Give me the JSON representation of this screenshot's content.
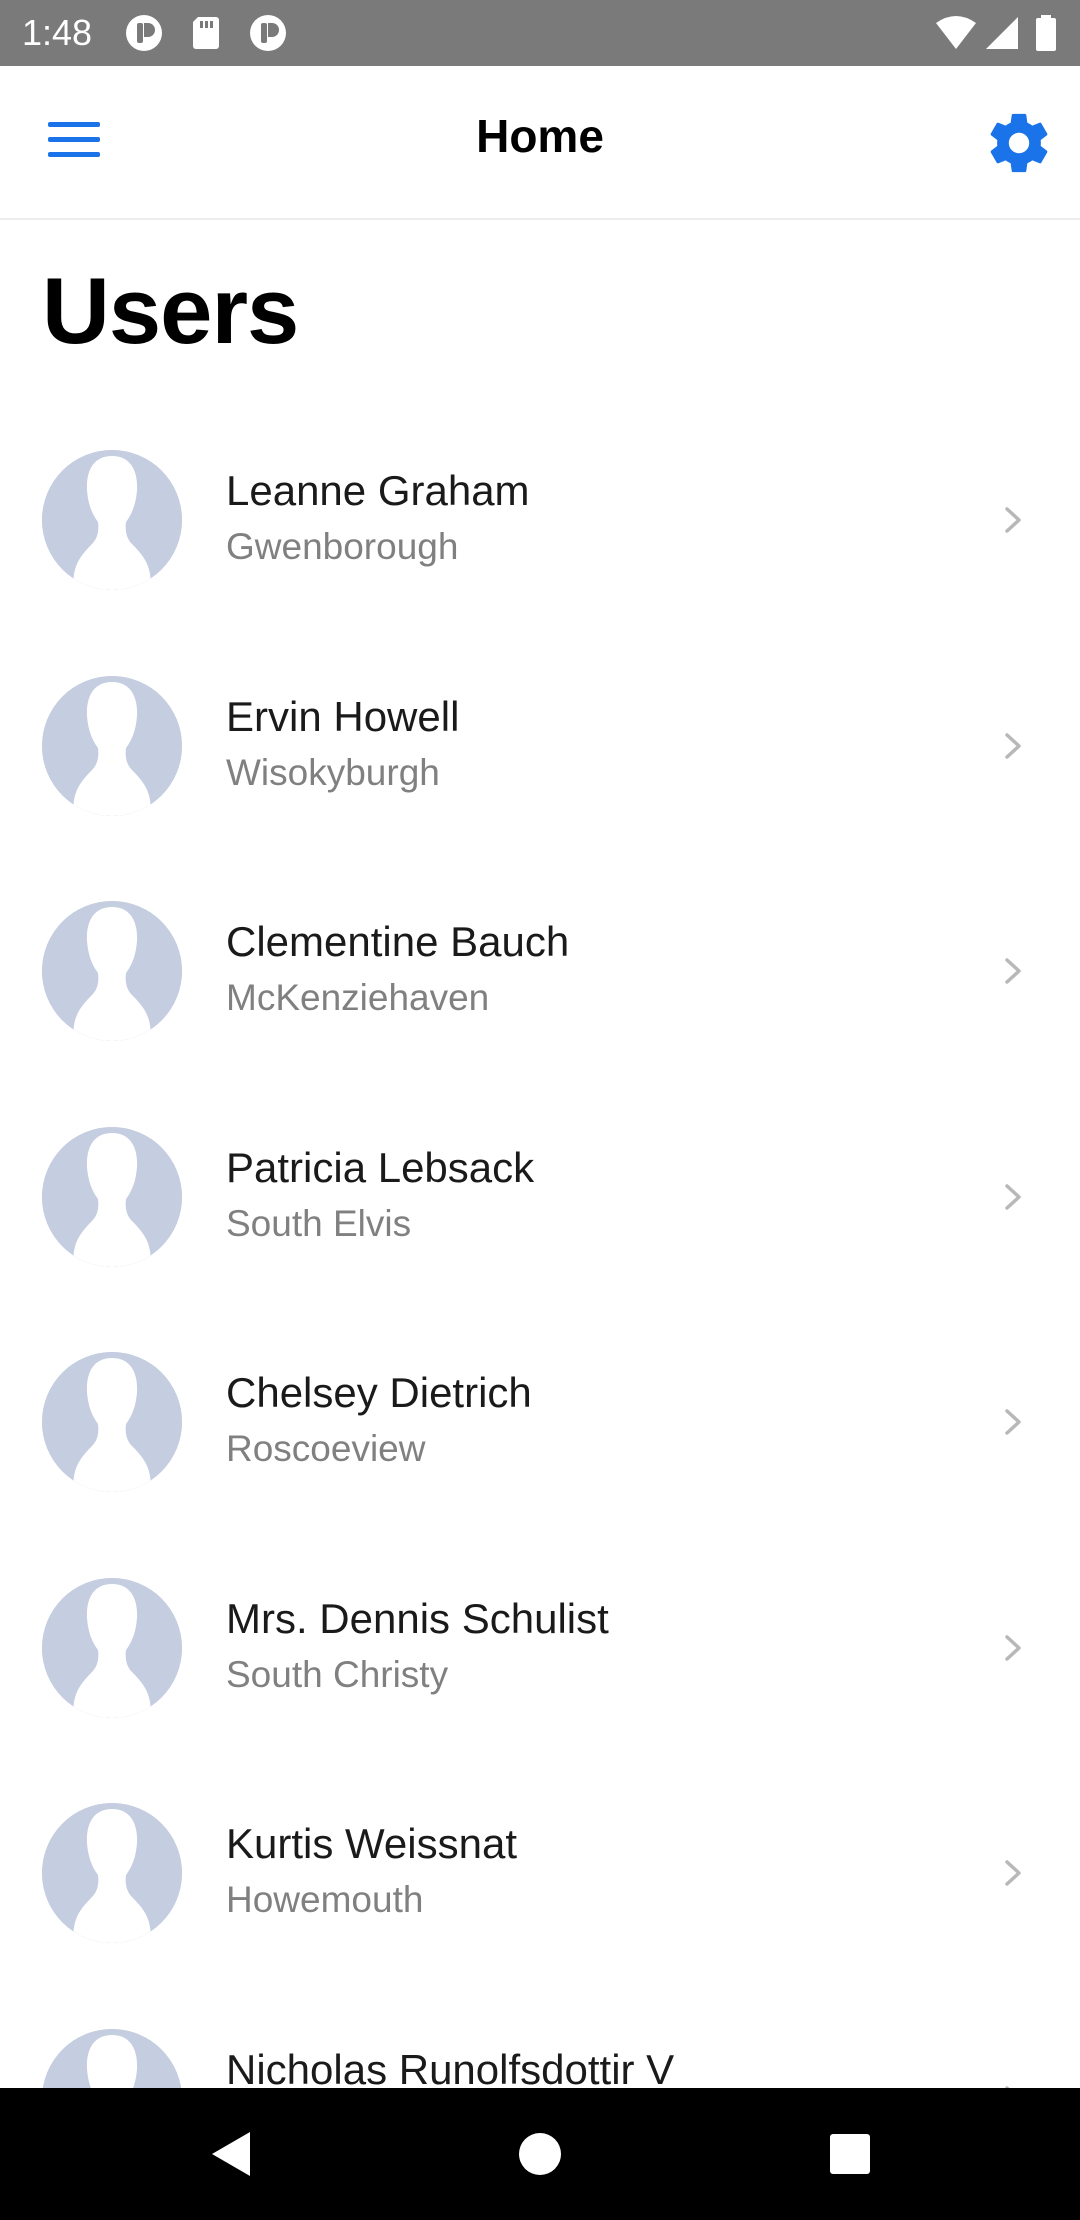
{
  "status_bar": {
    "time": "1:48",
    "left_icons": [
      "notification-app-icon",
      "sd-card-icon",
      "notification-app-icon"
    ],
    "right_icons": [
      "wifi-icon",
      "cellular-signal-icon",
      "battery-icon"
    ]
  },
  "app_bar": {
    "title": "Home",
    "menu_icon": "hamburger-menu-icon",
    "settings_icon": "gear-icon",
    "accent_color": "#1a73e8"
  },
  "section": {
    "heading": "Users"
  },
  "users": [
    {
      "name": "Leanne Graham",
      "city": "Gwenborough"
    },
    {
      "name": "Ervin Howell",
      "city": "Wisokyburgh"
    },
    {
      "name": "Clementine Bauch",
      "city": "McKenziehaven"
    },
    {
      "name": "Patricia Lebsack",
      "city": "South Elvis"
    },
    {
      "name": "Chelsey Dietrich",
      "city": "Roscoeview"
    },
    {
      "name": "Mrs. Dennis Schulist",
      "city": "South Christy"
    },
    {
      "name": "Kurtis Weissnat",
      "city": "Howemouth"
    },
    {
      "name": "Nicholas Runolfsdottir V",
      "city": ""
    }
  ],
  "colors": {
    "avatar_background": "#c5cde0",
    "avatar_silhouette": "#ffffff",
    "chevron": "#b8b8b8",
    "secondary_text": "#808080"
  },
  "nav_bar": {
    "back_icon": "back-triangle-icon",
    "home_icon": "home-circle-icon",
    "recents_icon": "recents-square-icon"
  }
}
